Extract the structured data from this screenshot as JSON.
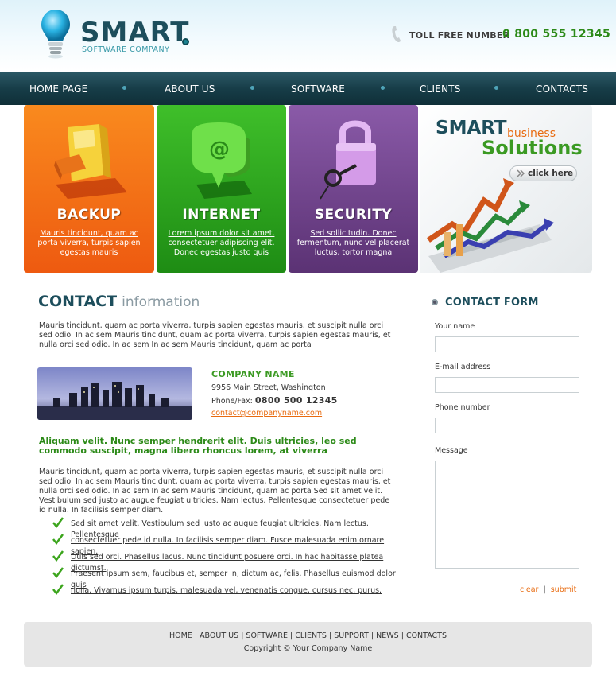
{
  "header": {
    "logo_title": "SMART",
    "logo_subtitle": "SOFTWARE COMPANY",
    "tollfree_label": "TOLL FREE NUMBER",
    "tollfree_number": "0 800 555 12345"
  },
  "nav": {
    "items": [
      {
        "label": "HOME PAGE"
      },
      {
        "label": "ABOUT US"
      },
      {
        "label": "SOFTWARE"
      },
      {
        "label": "CLIENTS"
      },
      {
        "label": "CONTACTS"
      }
    ]
  },
  "banner": {
    "tiles": [
      {
        "title": "BACKUP",
        "link": "Mauris tincidunt, quam ac",
        "text": "porta viverra, turpis sapien egestas mauris",
        "color": "#f0600f",
        "icon": "floppy-disk-icon"
      },
      {
        "title": "INTERNET",
        "link": "Lorem ipsum dolor sit amet,",
        "text": "consectetuer adipiscing elit. Donec egestas justo quis",
        "color": "#2fa11c",
        "icon": "at-sign-icon"
      },
      {
        "title": "SECURITY",
        "link": "Sed sollicitudin. Donec",
        "text": "fermentum, nunc vel placerat luctus, tortor magna",
        "color": "#6a3f84",
        "icon": "padlock-icon"
      }
    ],
    "promo": {
      "smart": "SMART",
      "business": "business",
      "solutions": "Solutions",
      "button": "click here"
    }
  },
  "contact": {
    "heading_bold": "CONTACT",
    "heading_light": "information",
    "intro": "Mauris tincidunt, quam ac porta viverra, turpis sapien egestas mauris, et suscipit nulla orci sed odio. In ac sem Mauris tincidunt, quam ac porta viverra, turpis sapien egestas mauris, et nulla orci sed odio. In ac sem In ac sem Mauris tincidunt, quam ac porta",
    "company_name": "COMPANY NAME",
    "street": "9956 Main Street, Washington",
    "phone_label": "Phone/Fax:",
    "phone_number": "0800 500 12345",
    "email": "contact@companyname.com",
    "green_heading": "Aliquam velit. Nunc semper hendrerit elit. Duis ultricies, leo sed commodo suscipit, magna libero rhoncus lorem, at viverra",
    "body": "Mauris tincidunt, quam ac porta viverra, turpis sapien egestas mauris, et suscipit nulla orci sed odio. In ac sem Mauris tincidunt, quam ac porta viverra, turpis sapien egestas mauris, et nulla orci sed odio. In ac sem In ac sem Mauris tincidunt, quam ac porta Sed sit amet velit. Vestibulum sed justo ac augue feugiat ultricies. Nam lectus. Pellentesque consectetuer pede id nulla. In facilisis semper diam.",
    "bullets": [
      "Sed sit amet velit. Vestibulum sed justo ac augue feugiat ultricies. Nam lectus. Pellentesque",
      "consectetuer pede id nulla. In facilisis semper diam. Fusce malesuada enim ornare sapien.",
      "Duis sed orci. Phasellus lacus. Nunc tincidunt posuere orci. In hac habitasse platea dictumst.",
      "Praesent ipsum sem, faucibus et, semper in, dictum ac, felis. Phasellus euismod dolor quis",
      "nulla. Vivamus ipsum turpis, malesuada vel, venenatis congue, cursus nec, purus."
    ]
  },
  "form": {
    "title": "CONTACT FORM",
    "name_label": "Your name",
    "email_label": "E-mail address",
    "phone_label": "Phone number",
    "message_label": "Message",
    "clear": "clear",
    "separator": "|",
    "submit": "submit"
  },
  "footer": {
    "links": [
      "HOME",
      "ABOUT US",
      "SOFTWARE",
      "CLIENTS",
      "SUPPORT",
      "NEWS",
      "CONTACTS"
    ],
    "separator": "|",
    "copyright": "Copyright © Your Company Name"
  }
}
